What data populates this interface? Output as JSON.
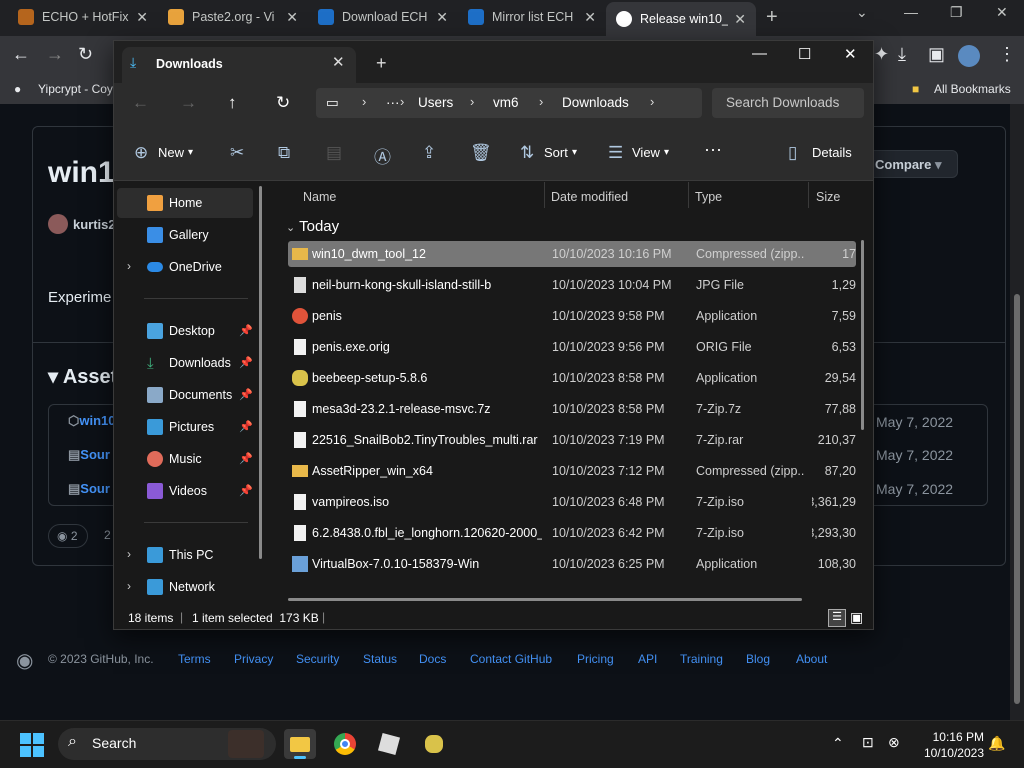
{
  "browser": {
    "tabs": [
      {
        "label": "ECHO + HotFix",
        "color": "#b5651d",
        "active": false
      },
      {
        "label": "Paste2.org - Vi",
        "color": "#e8a33d",
        "active": false
      },
      {
        "label": "Download ECH",
        "color": "#1e6fc7",
        "active": false
      },
      {
        "label": "Mirror list ECH",
        "color": "#1e6fc7",
        "active": false
      },
      {
        "label": "Release win10_",
        "color": "#ffffff",
        "active": true
      }
    ],
    "bookmarks": {
      "first": "Yipcrypt - Coy",
      "all": "All Bookmarks"
    }
  },
  "github": {
    "title": "win1",
    "user": "kurtis2",
    "experiment": "Experime",
    "assets_heading": "Asset",
    "compare": "Compare",
    "assets": [
      {
        "label": "win10",
        "date": "May 7, 2022"
      },
      {
        "label": "Sour",
        "date": "May 7, 2022"
      },
      {
        "label": "Sour",
        "date": "May 7, 2022"
      }
    ],
    "reactions": "2",
    "reactions2": "2",
    "footer": {
      "copyright": "© 2023 GitHub, Inc.",
      "links": [
        "Terms",
        "Privacy",
        "Security",
        "Status",
        "Docs",
        "Contact GitHub",
        "Pricing",
        "API",
        "Training",
        "Blog",
        "About"
      ]
    }
  },
  "explorer": {
    "tab_title": "Downloads",
    "breadcrumb": [
      "Users",
      "vm6",
      "Downloads"
    ],
    "search_placeholder": "Search Downloads",
    "commands": {
      "new": "New",
      "sort": "Sort",
      "view": "View",
      "details": "Details"
    },
    "sidebar": [
      {
        "label": "Home",
        "color": "#f0a040",
        "selected": true,
        "pinned": false,
        "chevron": false
      },
      {
        "label": "Gallery",
        "color": "#3a8ee6",
        "selected": false,
        "pinned": false,
        "chevron": false
      },
      {
        "label": "OneDrive",
        "color": "#2b8ae6",
        "selected": false,
        "pinned": false,
        "chevron": true
      },
      {
        "label": "Desktop",
        "color": "#4aa3df",
        "selected": false,
        "pinned": true,
        "chevron": false
      },
      {
        "label": "Downloads",
        "color": "#3fb37f",
        "selected": false,
        "pinned": true,
        "chevron": false
      },
      {
        "label": "Documents",
        "color": "#8aa9c8",
        "selected": false,
        "pinned": true,
        "chevron": false
      },
      {
        "label": "Pictures",
        "color": "#3a9ad9",
        "selected": false,
        "pinned": true,
        "chevron": false
      },
      {
        "label": "Music",
        "color": "#e06b5a",
        "selected": false,
        "pinned": true,
        "chevron": false
      },
      {
        "label": "Videos",
        "color": "#8a5ad6",
        "selected": false,
        "pinned": true,
        "chevron": false
      },
      {
        "label": "This PC",
        "color": "#3a9ad9",
        "selected": false,
        "pinned": false,
        "chevron": true
      },
      {
        "label": "Network",
        "color": "#3a9ad9",
        "selected": false,
        "pinned": false,
        "chevron": true
      }
    ],
    "columns": {
      "name": "Name",
      "date": "Date modified",
      "type": "Type",
      "size": "Size"
    },
    "group": "Today",
    "files": [
      {
        "name": "win10_dwm_tool_12",
        "date": "10/10/2023 10:16 PM",
        "type": "Compressed (zipp...",
        "size": "17",
        "icon": "zip-icon",
        "color": "#e8b84a",
        "selected": true
      },
      {
        "name": "neil-burn-kong-skull-island-still-b",
        "date": "10/10/2023 10:04 PM",
        "type": "JPG File",
        "size": "1,29",
        "icon": "image-file-icon",
        "color": "#dcdcdc",
        "selected": false
      },
      {
        "name": "penis",
        "date": "10/10/2023 9:58 PM",
        "type": "Application",
        "size": "7,59",
        "icon": "app-p-icon",
        "color": "#e0533a",
        "selected": false
      },
      {
        "name": "penis.exe.orig",
        "date": "10/10/2023 9:56 PM",
        "type": "ORIG File",
        "size": "6,53",
        "icon": "file-icon",
        "color": "#f2f2f2",
        "selected": false
      },
      {
        "name": "beebeep-setup-5.8.6",
        "date": "10/10/2023 8:58 PM",
        "type": "Application",
        "size": "29,54",
        "icon": "bee-icon",
        "color": "#d9c24a",
        "selected": false
      },
      {
        "name": "mesa3d-23.2.1-release-msvc.7z",
        "date": "10/10/2023 8:58 PM",
        "type": "7-Zip.7z",
        "size": "77,88",
        "icon": "file-icon",
        "color": "#f2f2f2",
        "selected": false
      },
      {
        "name": "22516_SnailBob2.TinyTroubles_multi.rar",
        "date": "10/10/2023 7:19 PM",
        "type": "7-Zip.rar",
        "size": "210,37",
        "icon": "file-icon",
        "color": "#f2f2f2",
        "selected": false
      },
      {
        "name": "AssetRipper_win_x64",
        "date": "10/10/2023 7:12 PM",
        "type": "Compressed (zipp...",
        "size": "87,20",
        "icon": "zip-icon",
        "color": "#e8b84a",
        "selected": false
      },
      {
        "name": "vampireos.iso",
        "date": "10/10/2023 6:48 PM",
        "type": "7-Zip.iso",
        "size": "3,361,29",
        "icon": "file-icon",
        "color": "#f2f2f2",
        "selected": false
      },
      {
        "name": "6.2.8438.0.fbl_ie_longhorn.120620-2000_a...",
        "date": "10/10/2023 6:42 PM",
        "type": "7-Zip.iso",
        "size": "3,293,30",
        "icon": "file-icon",
        "color": "#f2f2f2",
        "selected": false
      },
      {
        "name": "VirtualBox-7.0.10-158379-Win",
        "date": "10/10/2023 6:25 PM",
        "type": "Application",
        "size": "108,30",
        "icon": "virtualbox-icon",
        "color": "#6aa0d8",
        "selected": false
      }
    ],
    "status": {
      "count": "18 items",
      "selected": "1 item selected  173 KB"
    }
  },
  "taskbar": {
    "search": "Search",
    "time": "10:16 PM",
    "date": "10/10/2023"
  }
}
